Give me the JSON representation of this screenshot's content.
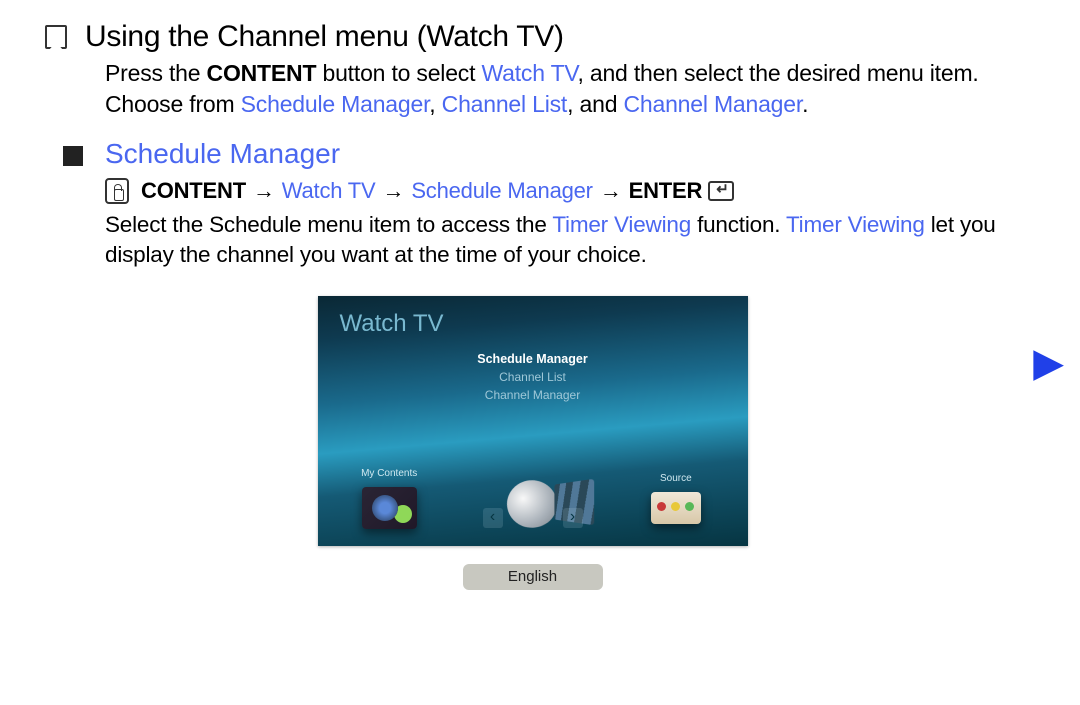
{
  "title": "Using the Channel menu (Watch TV)",
  "intro": {
    "pre": "Press the ",
    "btn": "CONTENT",
    "mid1": " button to select ",
    "watch": "Watch TV",
    "mid2": ", and then select the desired menu item. Choose from ",
    "opt1": "Schedule Manager",
    "sep1": ", ",
    "opt2": "Channel List",
    "sep2": ", and ",
    "opt3": "Channel Manager",
    "end": "."
  },
  "section_title": "Schedule Manager",
  "path": {
    "p1": "CONTENT",
    "arr": "→",
    "p2": "Watch TV",
    "p3": "Schedule Manager",
    "p4": "ENTER"
  },
  "body": {
    "t1": "Select the Schedule menu item to access the ",
    "tv1": "Timer Viewing",
    "t2": " function. ",
    "tv2": "Timer Viewing",
    "t3": " let you display the channel you want at the time of your choice."
  },
  "tv": {
    "title": "Watch TV",
    "menu": [
      "Schedule Manager",
      "Channel List",
      "Channel Manager"
    ],
    "selected_index": 0,
    "bottom_labels": {
      "left": "My Contents",
      "right": "Source"
    }
  },
  "language": "English"
}
